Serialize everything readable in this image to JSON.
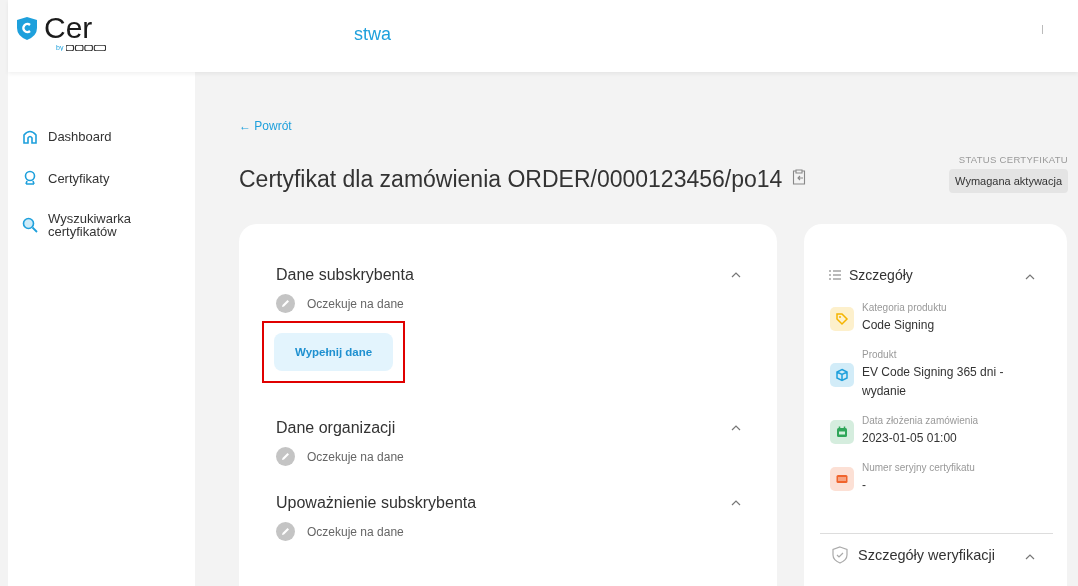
{
  "header": {
    "logo_text": "Cer",
    "logo_by": "by",
    "nav_text": "stwa"
  },
  "sidebar": {
    "items": [
      {
        "label": "Dashboard",
        "kind": "home"
      },
      {
        "label": "Certyfikaty",
        "kind": "award"
      },
      {
        "label": "Wyszukiwarka certyfikatów",
        "kind": "search"
      }
    ]
  },
  "back_link": "← Powrót",
  "title": "Certyfikat dla zamówienia ORDER/0000123456/po14",
  "status": {
    "label": "STATUS CERTYFIKATU",
    "value": "Wymagana aktywacja"
  },
  "sections": [
    {
      "title": "Dane subskrybenta",
      "status": "Oczekuje na dane",
      "expanded": true,
      "button": {
        "label": "Wypełnij dane",
        "highlighted": true
      }
    },
    {
      "title": "Dane organizacji",
      "status": "Oczekuje na dane",
      "expanded": true
    },
    {
      "title": "Upoważnienie subskrybenta",
      "status": "Oczekuje na dane",
      "expanded": true
    }
  ],
  "details": {
    "title": "Szczegóły",
    "expanded": true,
    "items": [
      {
        "label": "Kategoria produktu",
        "value": "Code Signing",
        "kind": "tag",
        "color": "#f5b400"
      },
      {
        "label": "Produkt",
        "value": "EV Code Signing 365 dni - wydanie",
        "kind": "box",
        "color": "#1ea0dc"
      },
      {
        "label": "Data złożenia zamówienia",
        "value": "2023-01-05 01:00",
        "kind": "calendar",
        "color": "#2fa659"
      },
      {
        "label": "Numer seryjny certyfikatu",
        "value": "-",
        "kind": "serial",
        "color": "#f0642d"
      }
    ]
  },
  "verification": {
    "title": "Szczegóły weryfikacji",
    "expanded": true
  }
}
